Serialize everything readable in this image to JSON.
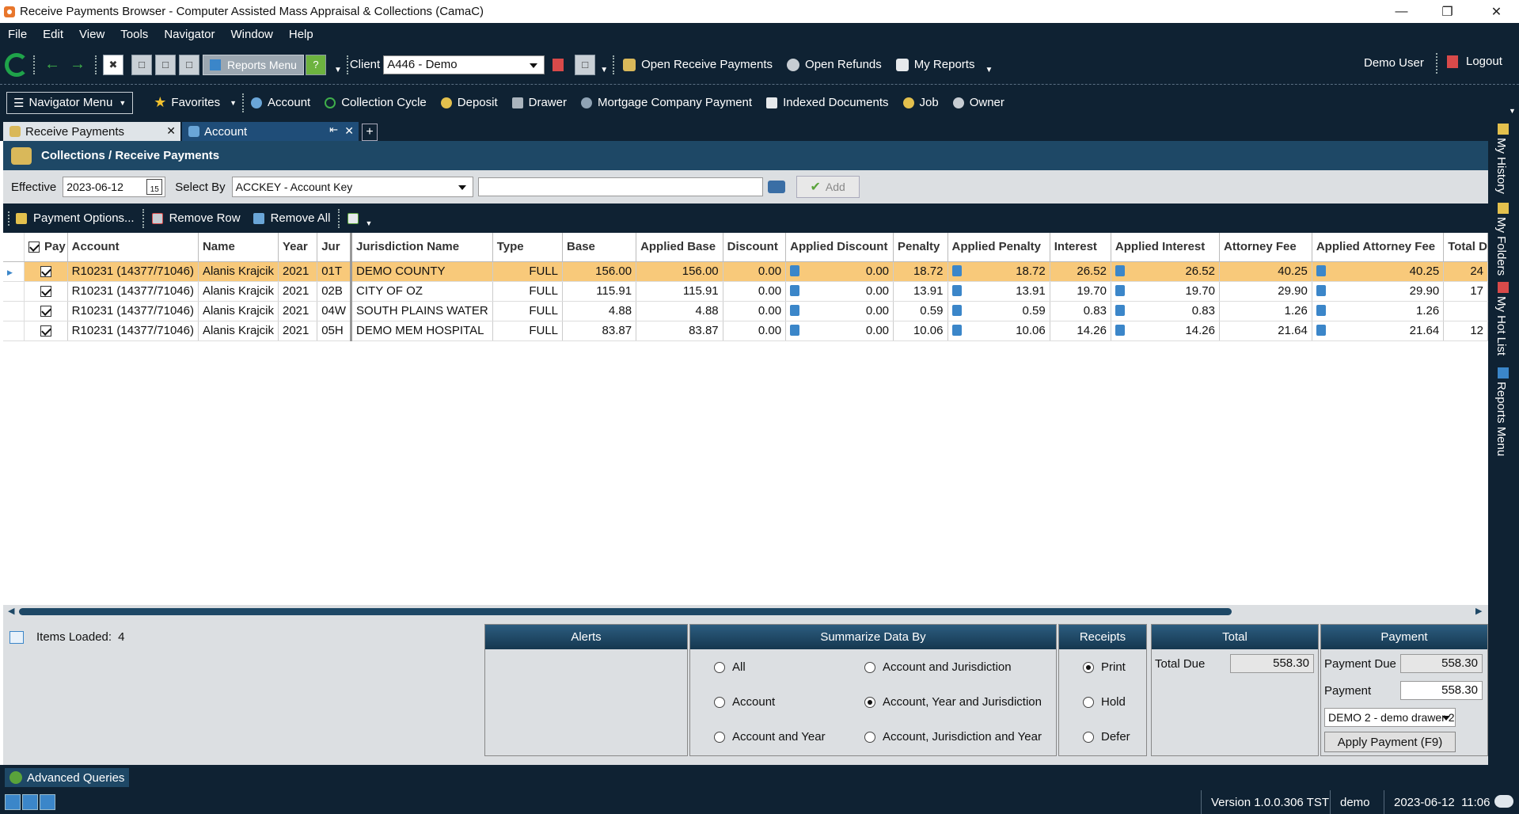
{
  "window": {
    "title": "Receive Payments Browser - Computer Assisted Mass Appraisal & Collections (CamaC)"
  },
  "menu": [
    "File",
    "Edit",
    "View",
    "Tools",
    "Navigator",
    "Window",
    "Help"
  ],
  "toolbar": {
    "reports_menu": "Reports Menu",
    "client_label": "Client",
    "client_value": "A446 - Demo",
    "links": [
      "Open Receive Payments",
      "Open Refunds",
      "My Reports"
    ],
    "user": "Demo User",
    "logout": "Logout"
  },
  "navbar": {
    "menu_label": "Navigator Menu",
    "favorites": "Favorites",
    "items": [
      "Account",
      "Collection Cycle",
      "Deposit",
      "Drawer",
      "Mortgage Company Payment",
      "Indexed Documents",
      "Job",
      "Owner"
    ]
  },
  "tabs": [
    {
      "label": "Receive Payments",
      "active": true
    },
    {
      "label": "Account",
      "active": false
    }
  ],
  "page": {
    "header": "Collections / Receive Payments",
    "effective_label": "Effective",
    "effective_value": "2023-06-12",
    "calendar_day": "15",
    "select_by_label": "Select By",
    "select_by_value": "ACCKEY - Account Key",
    "add_label": "Add"
  },
  "actions": [
    "Payment Options...",
    "Remove Row",
    "Remove All"
  ],
  "grid": {
    "columns": [
      "Pay",
      "Account",
      "Name",
      "Year",
      "Jur",
      "Jurisdiction Name",
      "Type",
      "Base",
      "Applied Base",
      "Discount",
      "Applied Discount",
      "Penalty",
      "Applied Penalty",
      "Interest",
      "Applied Interest",
      "Attorney Fee",
      "Applied Attorney Fee",
      "Total D"
    ],
    "rows": [
      {
        "account": "R10231 (14377/71046)",
        "name": "Alanis Krajcik",
        "year": "2021",
        "jur": "01T",
        "jur_name": "DEMO COUNTY",
        "type": "FULL",
        "base": "156.00",
        "applied_base": "156.00",
        "discount": "0.00",
        "applied_discount": "0.00",
        "penalty": "18.72",
        "applied_penalty": "18.72",
        "interest": "26.52",
        "applied_interest": "26.52",
        "attorney_fee": "40.25",
        "applied_attorney_fee": "40.25",
        "total": "24"
      },
      {
        "account": "R10231 (14377/71046)",
        "name": "Alanis Krajcik",
        "year": "2021",
        "jur": "02B",
        "jur_name": "CITY OF OZ",
        "type": "FULL",
        "base": "115.91",
        "applied_base": "115.91",
        "discount": "0.00",
        "applied_discount": "0.00",
        "penalty": "13.91",
        "applied_penalty": "13.91",
        "interest": "19.70",
        "applied_interest": "19.70",
        "attorney_fee": "29.90",
        "applied_attorney_fee": "29.90",
        "total": "17"
      },
      {
        "account": "R10231 (14377/71046)",
        "name": "Alanis Krajcik",
        "year": "2021",
        "jur": "04W",
        "jur_name": "SOUTH PLAINS WATER",
        "type": "FULL",
        "base": "4.88",
        "applied_base": "4.88",
        "discount": "0.00",
        "applied_discount": "0.00",
        "penalty": "0.59",
        "applied_penalty": "0.59",
        "interest": "0.83",
        "applied_interest": "0.83",
        "attorney_fee": "1.26",
        "applied_attorney_fee": "1.26",
        "total": ""
      },
      {
        "account": "R10231 (14377/71046)",
        "name": "Alanis Krajcik",
        "year": "2021",
        "jur": "05H",
        "jur_name": "DEMO MEM HOSPITAL",
        "type": "FULL",
        "base": "83.87",
        "applied_base": "83.87",
        "discount": "0.00",
        "applied_discount": "0.00",
        "penalty": "10.06",
        "applied_penalty": "10.06",
        "interest": "14.26",
        "applied_interest": "14.26",
        "attorney_fee": "21.64",
        "applied_attorney_fee": "21.64",
        "total": "12"
      }
    ]
  },
  "bottom": {
    "items_loaded_label": "Items Loaded:",
    "items_loaded_value": "4",
    "alerts_title": "Alerts",
    "summarize_title": "Summarize Data By",
    "summarize_options": [
      "All",
      "Account and Jurisdiction",
      "Account",
      "Account, Year and Jurisdiction",
      "Account and Year",
      "Account, Jurisdiction and Year"
    ],
    "summarize_selected": "Account, Year and Jurisdiction",
    "receipts_title": "Receipts",
    "receipts_options": [
      "Print",
      "Hold",
      "Defer"
    ],
    "receipts_selected": "Print",
    "total_title": "Total",
    "total_due_label": "Total Due",
    "total_due_value": "558.30",
    "payment_title": "Payment",
    "payment_due_label": "Payment Due",
    "payment_due_value": "558.30",
    "payment_label": "Payment",
    "payment_value": "558.30",
    "drawer_value": "DEMO 2 - demo drawer 2",
    "apply_label": "Apply Payment (F9)"
  },
  "sidebar": [
    "My History",
    "My Folders",
    "My Hot List",
    "Reports Menu"
  ],
  "advanced_queries": "Advanced Queries",
  "status": {
    "version": "Version 1.0.0.306 TST",
    "user": "demo",
    "datetime": "2023-06-12  11:06"
  },
  "colors": {
    "dark": "#0f2233",
    "header": "#1e4866",
    "selected_row": "#f8c97a"
  }
}
